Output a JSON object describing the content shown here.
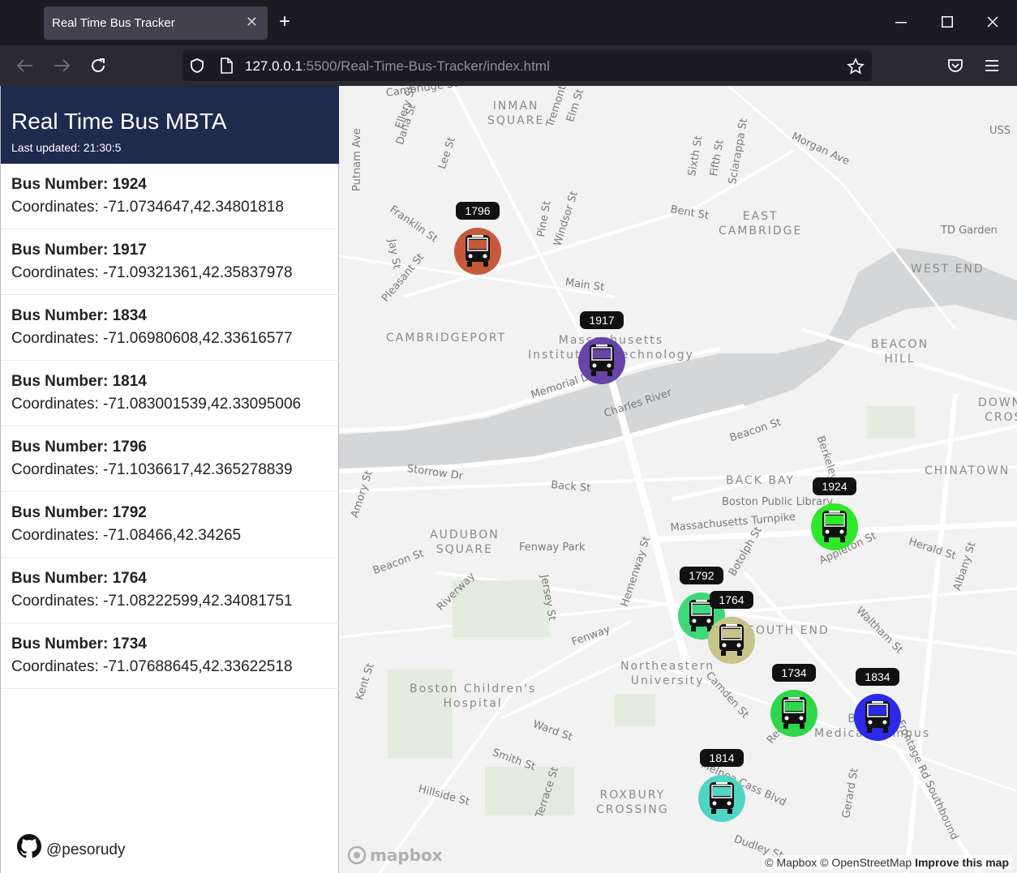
{
  "browser": {
    "tab_title": "Real Time Bus Tracker",
    "url_host": "127.0.0.1",
    "url_rest": ":5500/Real-Time-Bus-Tracker/index.html"
  },
  "sidebar": {
    "title": "Real Time Bus MBTA",
    "updated": "Last updated: 21:30:5",
    "github": "@pesorudy",
    "buses": [
      {
        "num": "Bus Number: 1924",
        "coord": "Coordinates: -71.0734647,42.34801818"
      },
      {
        "num": "Bus Number: 1917",
        "coord": "Coordinates: -71.09321361,42.35837978"
      },
      {
        "num": "Bus Number: 1834",
        "coord": "Coordinates: -71.06980608,42.33616577"
      },
      {
        "num": "Bus Number: 1814",
        "coord": "Coordinates: -71.083001539,42.33095006"
      },
      {
        "num": "Bus Number: 1796",
        "coord": "Coordinates: -71.1036617,42.365278839"
      },
      {
        "num": "Bus Number: 1792",
        "coord": "Coordinates: -71.08466,42.34265"
      },
      {
        "num": "Bus Number: 1764",
        "coord": "Coordinates: -71.08222599,42.34081751"
      },
      {
        "num": "Bus Number: 1734",
        "coord": "Coordinates: -71.07688645,42.33622518"
      }
    ]
  },
  "map": {
    "labels": [
      "Cambridge St",
      "INMAN\nSQUARE",
      "Tremont St",
      "Elm St",
      "Ellery St",
      "Dana St",
      "Lee St",
      "Putnam Ave",
      "Franklin St",
      "Jay St",
      "Pine St",
      "Windsor St",
      "Sixth St",
      "Fifth St",
      "Sciarappa St",
      "Morgan Ave",
      "USS",
      "Bent St",
      "EAST\nCAMBRIDGE",
      "TD Garden",
      "WEST END",
      "Main St",
      "Pleasant St",
      "CAMBRIDGEPORT",
      "Massachusetts\nInstitute of Technology",
      "BEACON\nHILL",
      "Memorial Dr",
      "Charles River",
      "DOWNTOWN\nCROSSING",
      "Beacon St",
      "Berkeley St",
      "Storrow Dr",
      "Back St",
      "BACK BAY",
      "CHINATOWN",
      "Boston Public Library",
      "Amory St",
      "AUDUBON\nSQUARE",
      "Fenway Park",
      "Massachusetts Turnpike",
      "Herald St",
      "Beacon St",
      "Jersey St",
      "Appleton St",
      "Riverway",
      "Hemenway St",
      "Botolph St",
      "Waltham St",
      "Albany St",
      "Fenway",
      "SOUTH END",
      "Northeastern\nUniversity",
      "Camden St",
      "Boston Children's\nHospital",
      "Kent St",
      "Ward St",
      "Smith St",
      "Boston\nMedical Campus",
      "Frontage Rd Southbound",
      "Melnea Cass Blvd",
      "Reed St",
      "Hillside St",
      "ROXBURY\nCROSSING",
      "Terrace St",
      "Dudley St",
      "Gerard St"
    ],
    "markers": [
      {
        "label": "1796",
        "color": "#c85a3c"
      },
      {
        "label": "1917",
        "color": "#6644a8"
      },
      {
        "label": "1924",
        "color": "#2ee82a"
      },
      {
        "label": "1792",
        "color": "#3ed87a"
      },
      {
        "label": "1764",
        "color": "#c8c48a"
      },
      {
        "label": "1734",
        "color": "#2ed84a"
      },
      {
        "label": "1834",
        "color": "#2a2ae8"
      },
      {
        "label": "1814",
        "color": "#50d4c4"
      }
    ],
    "logo": "mapbox",
    "attribution": "© Mapbox © OpenStreetMap",
    "improve": "Improve this map"
  }
}
